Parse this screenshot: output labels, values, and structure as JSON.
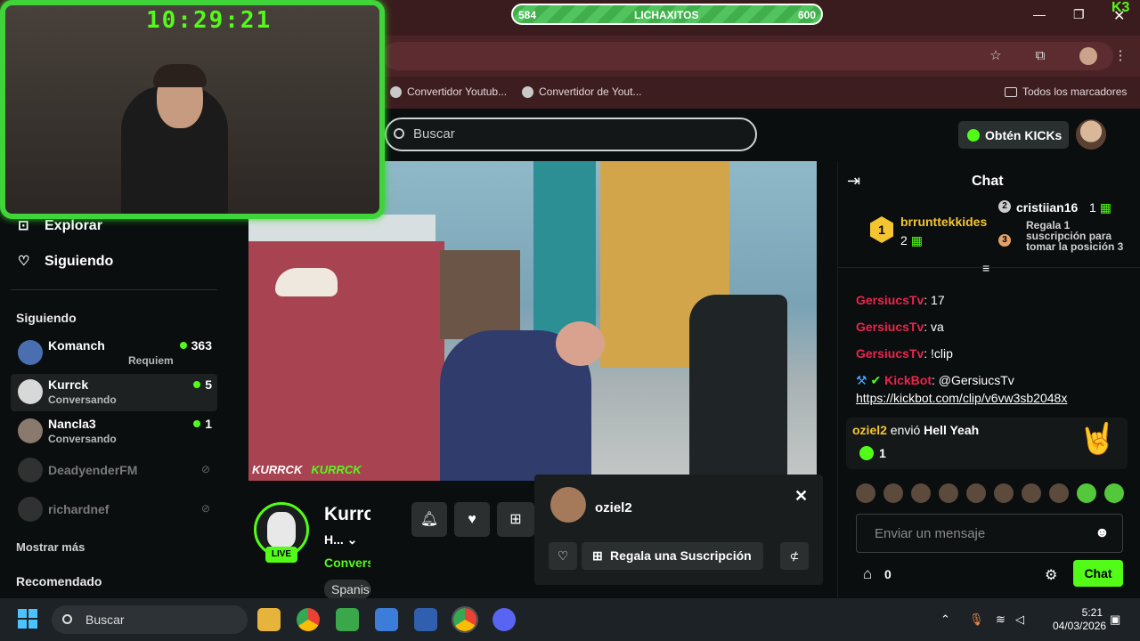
{
  "browser": {
    "bookmarks": [
      "Convertidor Youtub...",
      "Convertidor de Yout..."
    ],
    "all_bookmarks": "Todos los marcadores"
  },
  "overlay": {
    "clock": "10:29:21",
    "goal_left": "584",
    "goal_label": "LICHAXITOS",
    "goal_right": "600",
    "goal_progress": 0.97,
    "corner_badge": "K3",
    "handles": [
      "KURRCK",
      "KURRCK"
    ]
  },
  "header": {
    "search_placeholder": "Buscar",
    "kicks_button": "Obtén KICKs"
  },
  "sidebar": {
    "nav": [
      {
        "label": "Explorar",
        "icon": "compass-icon"
      },
      {
        "label": "Siguiendo",
        "icon": "heart-icon"
      }
    ],
    "following_header": "Siguiendo",
    "following": [
      {
        "name": "Komanch",
        "sub": "Requiem",
        "count": "363",
        "live": true
      },
      {
        "name": "Kurrck",
        "sub": "Conversando",
        "count": "5",
        "live": true
      },
      {
        "name": "Nancla3",
        "sub": "Conversando",
        "count": "1",
        "live": true
      },
      {
        "name": "DeadyenderFM",
        "live": false
      },
      {
        "name": "richardnef",
        "live": false
      }
    ],
    "show_more": "Mostrar más",
    "recommended": "Recomendado"
  },
  "channel": {
    "name": "Kurrck",
    "title": "H...",
    "category": "Conversando",
    "tag": "Spanish",
    "live_badge": "LIVE"
  },
  "popup": {
    "username": "oziel2",
    "gift_button": "Regala una Suscripción"
  },
  "chat": {
    "title": "Chat",
    "pinned": [
      {
        "rank": "1",
        "name": "brrunttekkides",
        "count": "2"
      },
      {
        "rank": "2",
        "name": "cristiian16",
        "count": "1",
        "text": "Regala 1 suscripción para tomar la posición 3"
      }
    ],
    "pin3_rank": "3",
    "messages": [
      {
        "user": "GersiucsTv",
        "text": "17"
      },
      {
        "user": "GersiucsTv",
        "text": "va"
      },
      {
        "user": "GersiucsTv",
        "text": "!clip"
      },
      {
        "user": "KickBot",
        "text": "@GersiucsTv"
      }
    ],
    "link": "https://kickbot.com/clip/v6vw3sb2048x",
    "gift": {
      "user": "oziel2",
      "verb": "envió",
      "item": "Hell Yeah",
      "count": "1"
    },
    "input_placeholder": "Enviar un mensaje",
    "gift_count": "0",
    "send_button": "Chat"
  },
  "taskbar": {
    "search": "Buscar",
    "time": "5:21",
    "date": "04/03/2026"
  }
}
